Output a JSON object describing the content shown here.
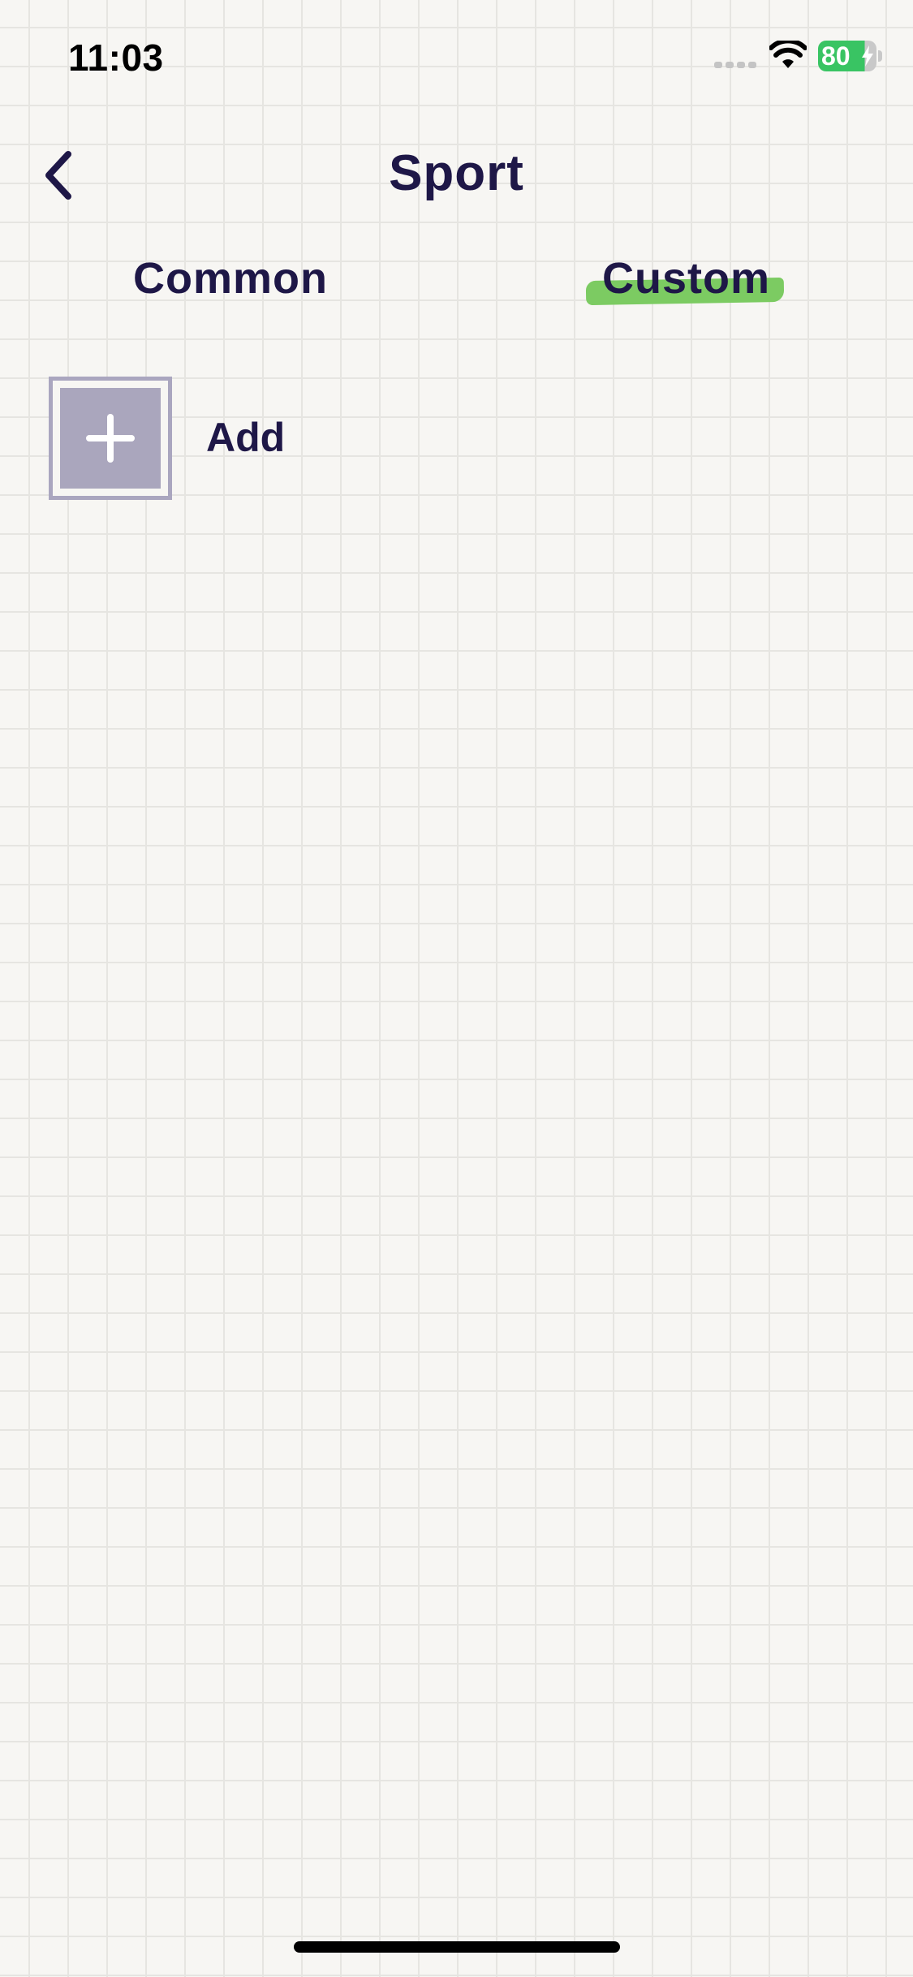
{
  "status_bar": {
    "time": "11:03",
    "battery_level": "80",
    "battery_color": "#39c463",
    "icons": [
      "signal-icon",
      "wifi-icon",
      "battery-icon",
      "bolt-icon"
    ]
  },
  "nav": {
    "back_icon": "chevron-left-icon",
    "title": "Sport"
  },
  "tabs": [
    {
      "label": "Common",
      "active": false
    },
    {
      "label": "Custom",
      "active": true
    }
  ],
  "active_tab_highlight_color": "#7ccb62",
  "items": [
    {
      "label": "Add",
      "icon": "plus-icon",
      "tile_color": "#aaa6bd"
    }
  ],
  "colors": {
    "text": "#1e1747",
    "background": "#f7f6f3",
    "grid_line": "#e6e5e1"
  }
}
